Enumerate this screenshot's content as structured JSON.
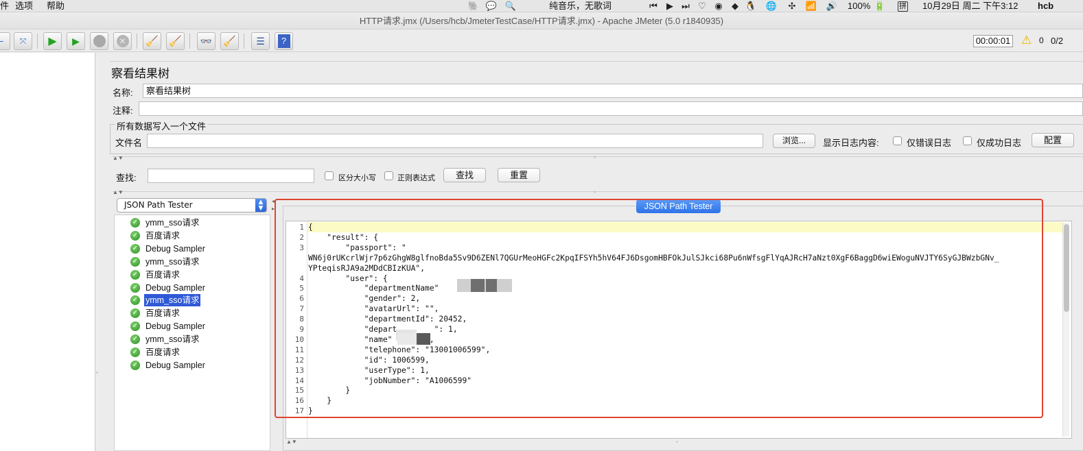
{
  "menubar": {
    "items": [
      "件",
      "选项",
      "帮助"
    ],
    "now_playing": "纯音乐，无歌词",
    "battery": "100%",
    "input_method": "拼",
    "datetime": "10月29日 周二 下午3:12",
    "user": "hcb"
  },
  "window": {
    "title": "HTTP请求.jmx (/Users/hcb/JmeterTestCase/HTTP请求.jmx) - Apache JMeter (5.0 r1840935)"
  },
  "toolbar": {
    "elapsed": "00:00:01",
    "warnings": "0",
    "threads": "0/2"
  },
  "panel": {
    "title": "察看结果树",
    "name_label": "名称:",
    "name_value": "察看结果树",
    "comment_label": "注释:",
    "comment_value": "",
    "file_group_title": "所有数据写入一个文件",
    "filename_label": "文件名",
    "filename_value": "",
    "browse_label": "浏览...",
    "log_display_label": "显示日志内容:",
    "errors_only_label": "仅错误日志",
    "success_only_label": "仅成功日志",
    "configure_label": "配置"
  },
  "search": {
    "label": "查找:",
    "value": "",
    "case_sensitive_label": "区分大小写",
    "regex_label": "正则表达式",
    "find_label": "查找",
    "reset_label": "重置"
  },
  "renderer": {
    "selected": "JSON Path Tester",
    "tab_label": "JSON Path Tester"
  },
  "results": [
    {
      "label": "ymm_sso请求",
      "status": "success",
      "selected": false
    },
    {
      "label": "百度请求",
      "status": "success",
      "selected": false
    },
    {
      "label": "Debug Sampler",
      "status": "success",
      "selected": false
    },
    {
      "label": "ymm_sso请求",
      "status": "success",
      "selected": false
    },
    {
      "label": "百度请求",
      "status": "success",
      "selected": false
    },
    {
      "label": "Debug Sampler",
      "status": "success",
      "selected": false
    },
    {
      "label": "ymm_sso请求",
      "status": "success",
      "selected": true
    },
    {
      "label": "百度请求",
      "status": "success",
      "selected": false
    },
    {
      "label": "Debug Sampler",
      "status": "success",
      "selected": false
    },
    {
      "label": "ymm_sso请求",
      "status": "success",
      "selected": false
    },
    {
      "label": "百度请求",
      "status": "success",
      "selected": false
    },
    {
      "label": "Debug Sampler",
      "status": "success",
      "selected": false
    }
  ],
  "editor": {
    "lines": [
      {
        "n": "1",
        "text": "{"
      },
      {
        "n": "2",
        "text": "    \"result\": {"
      },
      {
        "n": "3",
        "text": "        \"passport\": \""
      },
      {
        "n": "",
        "text": "WN6j0rUKcrlWjr7p6zGhgW8glfnoBda5Sv9D6ZENl7QGUrMeoHGFc2KpqIFSYh5hV64FJ6DsgomHBFOkJulSJkci68Pu6nWfsgFlYqAJRcH7aNzt0XgF6BaggD6wiEWoguNVJTY6SyGJBWzbGNv_"
      },
      {
        "n": "",
        "text": "YPteqisRJA9a2MDdCBIzKUA\","
      },
      {
        "n": "4",
        "text": "        \"user\": {"
      },
      {
        "n": "5",
        "text": "            \"departmentName\""
      },
      {
        "n": "6",
        "text": "            \"gender\": 2,"
      },
      {
        "n": "7",
        "text": "            \"avatarUrl\": \"\","
      },
      {
        "n": "8",
        "text": "            \"departmentId\": 20452,"
      },
      {
        "n": "9",
        "text": "            \"depart        \": 1,"
      },
      {
        "n": "10",
        "text": "            \"name\"        ,"
      },
      {
        "n": "11",
        "text": "            \"telephone\": \"13001006599\","
      },
      {
        "n": "12",
        "text": "            \"id\": 1006599,"
      },
      {
        "n": "13",
        "text": "            \"userType\": 1,"
      },
      {
        "n": "14",
        "text": "            \"jobNumber\": \"A1006599\""
      },
      {
        "n": "15",
        "text": "        }"
      },
      {
        "n": "16",
        "text": "    }"
      },
      {
        "n": "17",
        "text": "}"
      }
    ]
  },
  "colors": {
    "accent": "#2f72e8",
    "selection": "#2f59d6",
    "highlight_line": "#fdfbc5",
    "annotation": "#e0432f",
    "success": "#2c8e24"
  }
}
